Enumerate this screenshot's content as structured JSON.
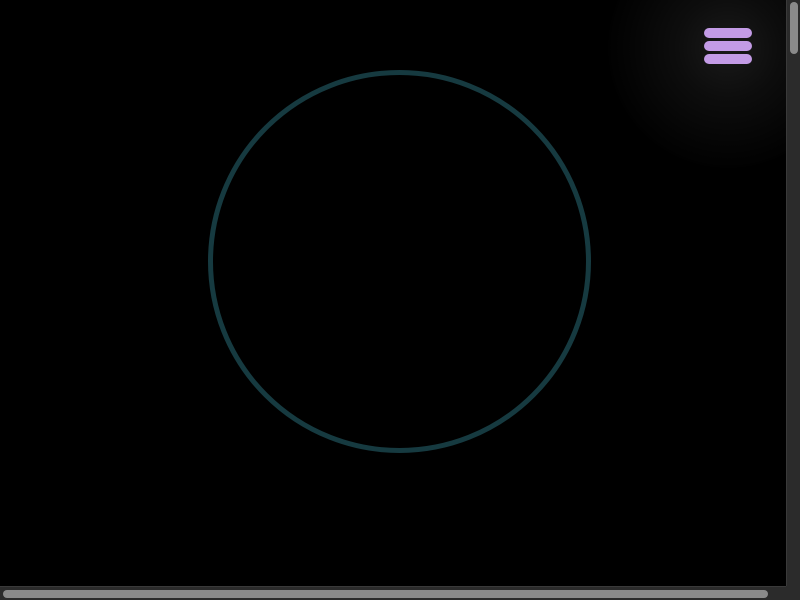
{
  "colors": {
    "background": "#000000",
    "ring_stroke": "#163a40",
    "menu_accent": "#c39be6",
    "scrollbar_track": "#2b2b2b",
    "scrollbar_thumb": "#8a8a8a"
  },
  "header": {
    "menu_icon": "hamburger-menu-icon"
  },
  "main": {
    "ring_icon": "ring-outline"
  }
}
